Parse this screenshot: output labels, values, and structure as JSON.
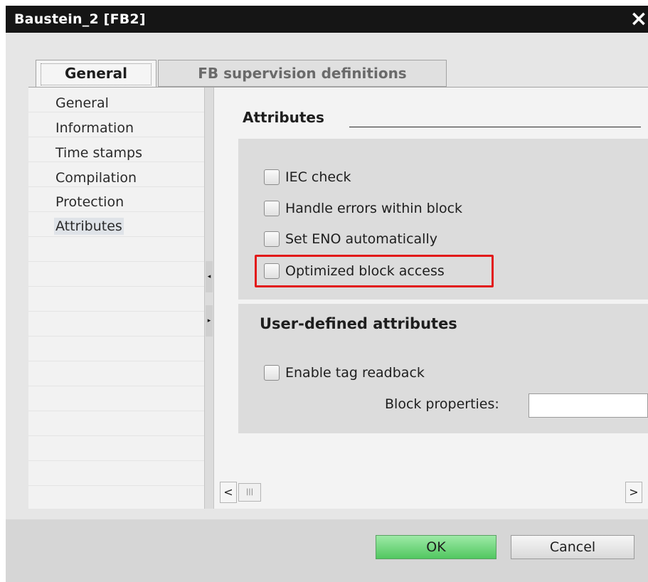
{
  "window": {
    "title": "Baustein_2 [FB2]",
    "close_glyph": "×"
  },
  "tabs": [
    {
      "label": "General",
      "active": true
    },
    {
      "label": "FB supervision definitions",
      "active": false
    }
  ],
  "nav": {
    "items": [
      {
        "label": "General"
      },
      {
        "label": "Information"
      },
      {
        "label": "Time stamps"
      },
      {
        "label": "Compilation"
      },
      {
        "label": "Protection"
      },
      {
        "label": "Attributes",
        "selected": true
      }
    ]
  },
  "splitter": {
    "collapse_glyph": "◂",
    "expand_glyph": "▸"
  },
  "attributes": {
    "title": "Attributes",
    "options": [
      {
        "label": "IEC check",
        "checked": false
      },
      {
        "label": "Handle errors within block",
        "checked": false
      },
      {
        "label": "Set ENO automatically",
        "checked": false
      },
      {
        "label": "Optimized block access",
        "checked": false,
        "highlighted": true
      }
    ]
  },
  "user_defined": {
    "title": "User-defined attributes",
    "enable_tag_readback": {
      "label": "Enable tag readback",
      "checked": false
    },
    "block_properties": {
      "label": "Block properties:",
      "value": ""
    }
  },
  "scrollbar": {
    "left_glyph": "<",
    "right_glyph": ">",
    "thumb_glyph": "|||"
  },
  "footer": {
    "ok_label": "OK",
    "cancel_label": "Cancel"
  },
  "colors": {
    "titlebar": "#151515",
    "highlight": "#e21a1a",
    "ok_button": "#51c760"
  }
}
